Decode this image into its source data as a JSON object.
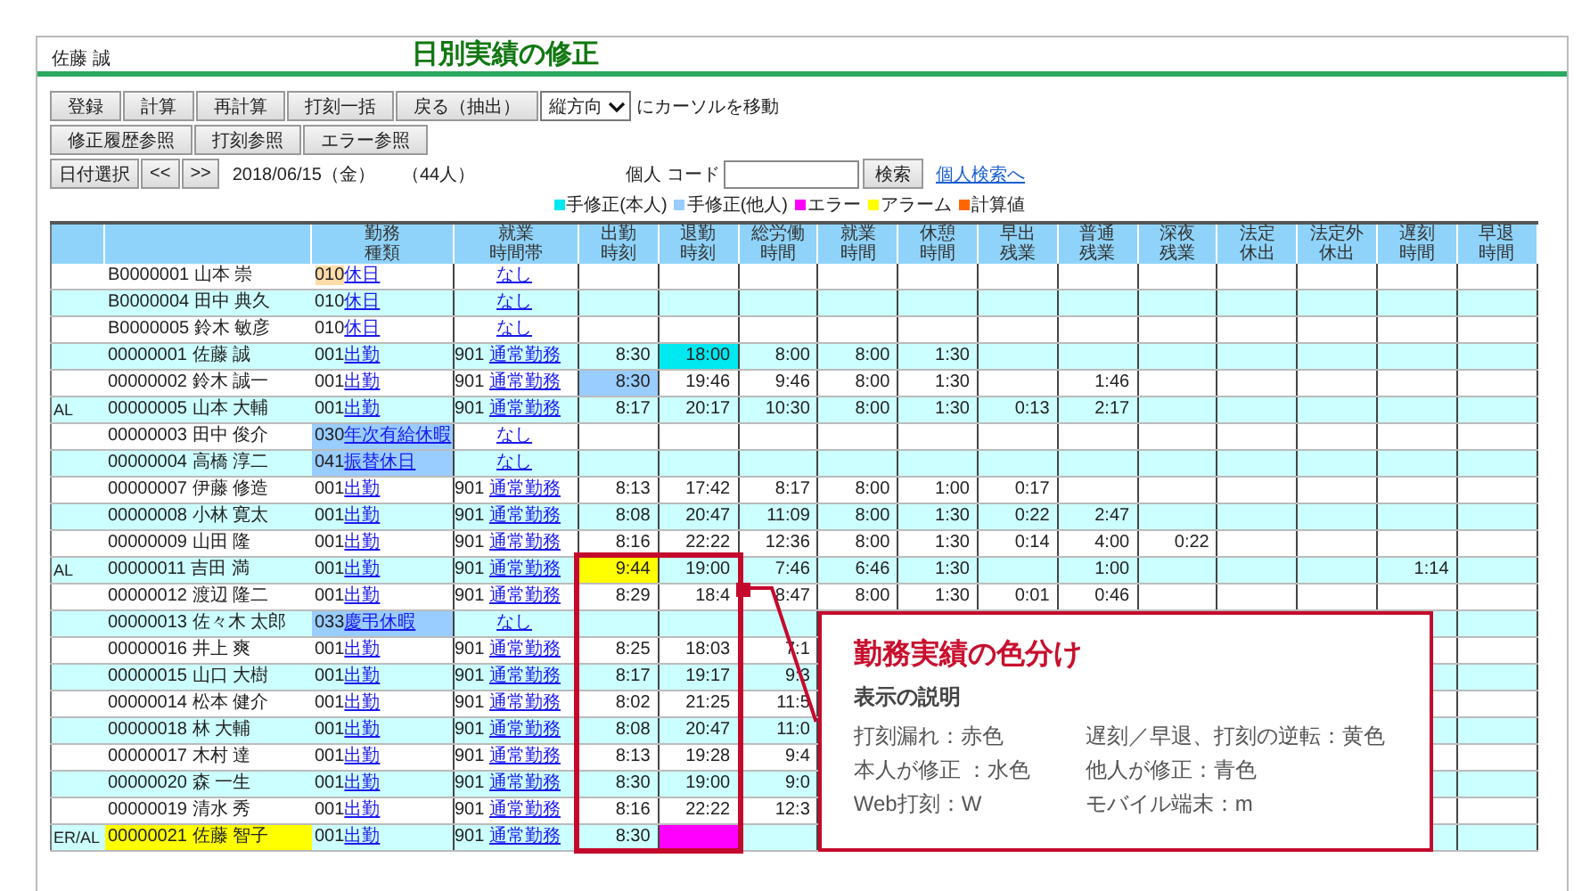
{
  "header": {
    "user": "佐藤 誠",
    "title": "日別実績の修正"
  },
  "actions_1": [
    "登録",
    "計算",
    "再計算",
    "打刻一括",
    "戻る（抽出）"
  ],
  "cursor_select": {
    "value": "縦方向",
    "label": "にカーソルを移動"
  },
  "actions_2": [
    "修正履歴参照",
    "打刻参照",
    "エラー参照"
  ],
  "date_nav": {
    "buttons": [
      "日付選択",
      "<<",
      ">>"
    ],
    "date": "2018/06/15（金）",
    "count": "（44人）"
  },
  "search": {
    "label": "個人 コード",
    "button": "検索",
    "link": "個人検索へ"
  },
  "legend": [
    {
      "label": "手修正(本人)",
      "color": "#00e8f0"
    },
    {
      "label": "手修正(他人)",
      "color": "#99ccff"
    },
    {
      "label": "エラー",
      "color": "#ff00ff"
    },
    {
      "label": "アラーム",
      "color": "#ffff00"
    },
    {
      "label": "計算値",
      "color": "#ff6600"
    }
  ],
  "table": {
    "columns": [
      [
        "勤務",
        "種類"
      ],
      [
        "就業",
        "時間帯"
      ],
      [
        "出勤",
        "時刻"
      ],
      [
        "退勤",
        "時刻"
      ],
      [
        "総労働",
        "時間"
      ],
      [
        "就業",
        "時間"
      ],
      [
        "休憩",
        "時間"
      ],
      [
        "早出",
        "残業"
      ],
      [
        "普通",
        "残業"
      ],
      [
        "深夜",
        "残業"
      ],
      [
        "法定",
        "休出"
      ],
      [
        "法定外",
        "休出"
      ],
      [
        "遅刻",
        "時間"
      ],
      [
        "早退",
        "時間"
      ]
    ],
    "rows": [
      {
        "employee": "B0000001 山本 崇",
        "work": {
          "code": "010",
          "label": "休日",
          "code_cell": {
            "color": "#ffdcaa"
          }
        },
        "shift": {
          "label": "なし"
        }
      },
      {
        "employee": "B0000004 田中 典久",
        "work": {
          "code": "010",
          "label": "休日"
        },
        "shift": {
          "label": "なし"
        }
      },
      {
        "employee": "B0000005 鈴木 敏彦",
        "work": {
          "code": "010",
          "label": "休日"
        },
        "shift": {
          "label": "なし"
        }
      },
      {
        "employee": "00000001 佐藤 誠",
        "work": {
          "code": "001",
          "label": "出勤"
        },
        "shift": {
          "code": "901",
          "label": "通常勤務"
        },
        "cells": [
          "8:30",
          {
            "text": "18:00",
            "color": "#00e8f0"
          },
          "8:00",
          "8:00",
          "1:30"
        ]
      },
      {
        "employee": "00000002 鈴木 誠一",
        "work": {
          "code": "001",
          "label": "出勤"
        },
        "shift": {
          "code": "901",
          "label": "通常勤務"
        },
        "cells": [
          {
            "text": "8:30",
            "color": "#99ccff"
          },
          "19:46",
          "9:46",
          "8:00",
          "1:30",
          null,
          "1:46"
        ]
      },
      {
        "flag": "AL",
        "employee": "00000005 山本 大輔",
        "work": {
          "code": "001",
          "label": "出勤"
        },
        "shift": {
          "code": "901",
          "label": "通常勤務"
        },
        "cells": [
          "8:17",
          "20:17",
          "10:30",
          "8:00",
          "1:30",
          "0:13",
          "2:17"
        ]
      },
      {
        "employee": "00000003 田中 俊介",
        "work": {
          "code": "030",
          "label": "年次有給休暇",
          "color": "#99ccff"
        },
        "shift": {
          "label": "なし"
        }
      },
      {
        "employee": "00000004 高橋 淳二",
        "work": {
          "code": "041",
          "label": "振替休日",
          "color": "#99ccff"
        },
        "shift": {
          "label": "なし"
        }
      },
      {
        "employee": "00000007 伊藤 修造",
        "work": {
          "code": "001",
          "label": "出勤"
        },
        "shift": {
          "code": "901",
          "label": "通常勤務"
        },
        "cells": [
          "8:13",
          "17:42",
          "8:17",
          "8:00",
          "1:00",
          "0:17"
        ]
      },
      {
        "employee": "00000008 小林 寛太",
        "work": {
          "code": "001",
          "label": "出勤"
        },
        "shift": {
          "code": "901",
          "label": "通常勤務"
        },
        "cells": [
          "8:08",
          "20:47",
          "11:09",
          "8:00",
          "1:30",
          "0:22",
          "2:47"
        ]
      },
      {
        "employee": "00000009 山田 隆",
        "work": {
          "code": "001",
          "label": "出勤"
        },
        "shift": {
          "code": "901",
          "label": "通常勤務"
        },
        "cells": [
          "8:16",
          "22:22",
          "12:36",
          "8:00",
          "1:30",
          "0:14",
          "4:00",
          "0:22"
        ]
      },
      {
        "flag": "AL",
        "employee": "00000011 吉田 満",
        "work": {
          "code": "001",
          "label": "出勤"
        },
        "shift": {
          "code": "901",
          "label": "通常勤務"
        },
        "cells": [
          {
            "text": "9:44",
            "color": "#ffff00"
          },
          "19:00",
          "7:46",
          "6:46",
          "1:30",
          null,
          "1:00",
          null,
          null,
          null,
          "1:14"
        ]
      },
      {
        "employee": "00000012 渡辺 隆二",
        "work": {
          "code": "001",
          "label": "出勤"
        },
        "shift": {
          "code": "901",
          "label": "通常勤務"
        },
        "cells": [
          "8:29",
          "18:4",
          "8:47",
          "8:00",
          "1:30",
          "0:01",
          "0:46"
        ]
      },
      {
        "employee": "00000013 佐々木 太郎",
        "work": {
          "code": "033",
          "label": "慶弔休暇",
          "color": "#99ccff"
        },
        "shift": {
          "label": "なし"
        }
      },
      {
        "employee": "00000016 井上 爽",
        "work": {
          "code": "001",
          "label": "出勤"
        },
        "shift": {
          "code": "901",
          "label": "通常勤務"
        },
        "cells": [
          "8:25",
          "18:03",
          "7:1"
        ]
      },
      {
        "employee": "00000015 山口 大樹",
        "work": {
          "code": "001",
          "label": "出勤"
        },
        "shift": {
          "code": "901",
          "label": "通常勤務"
        },
        "cells": [
          "8:17",
          "19:17",
          "9:3"
        ]
      },
      {
        "employee": "00000014 松本 健介",
        "work": {
          "code": "001",
          "label": "出勤"
        },
        "shift": {
          "code": "901",
          "label": "通常勤務"
        },
        "cells": [
          "8:02",
          "21:25",
          "11:5"
        ]
      },
      {
        "employee": "00000018 林 大輔",
        "work": {
          "code": "001",
          "label": "出勤"
        },
        "shift": {
          "code": "901",
          "label": "通常勤務"
        },
        "cells": [
          "8:08",
          "20:47",
          "11:0"
        ]
      },
      {
        "employee": "00000017 木村 達",
        "work": {
          "code": "001",
          "label": "出勤"
        },
        "shift": {
          "code": "901",
          "label": "通常勤務"
        },
        "cells": [
          "8:13",
          "19:28",
          "9:4"
        ]
      },
      {
        "employee": "00000020 森 一生",
        "work": {
          "code": "001",
          "label": "出勤"
        },
        "shift": {
          "code": "901",
          "label": "通常勤務"
        },
        "cells": [
          "8:30",
          "19:00",
          "9:0"
        ]
      },
      {
        "employee": "00000019 清水 秀",
        "work": {
          "code": "001",
          "label": "出勤"
        },
        "shift": {
          "code": "901",
          "label": "通常勤務"
        },
        "cells": [
          "8:16",
          "22:22",
          "12:3"
        ]
      },
      {
        "flag": "ER/AL",
        "employee": "00000021 佐藤 智子",
        "employee_cell": {
          "color": "#ffff00"
        },
        "work": {
          "code": "001",
          "label": "出勤"
        },
        "shift": {
          "code": "901",
          "label": "通常勤務"
        },
        "cells": [
          "8:30",
          {
            "color": "#ff00ff"
          }
        ]
      }
    ]
  },
  "callout": {
    "title": "勤務実績の色分け",
    "subtitle": "表示の説明",
    "items": [
      "打刻漏れ：赤色",
      "遅刻／早退、打刻の逆転：黄色",
      "本人が修正 ：水色",
      "他人が修正：青色",
      "Web打刻：W",
      "モバイル端末：m"
    ]
  }
}
